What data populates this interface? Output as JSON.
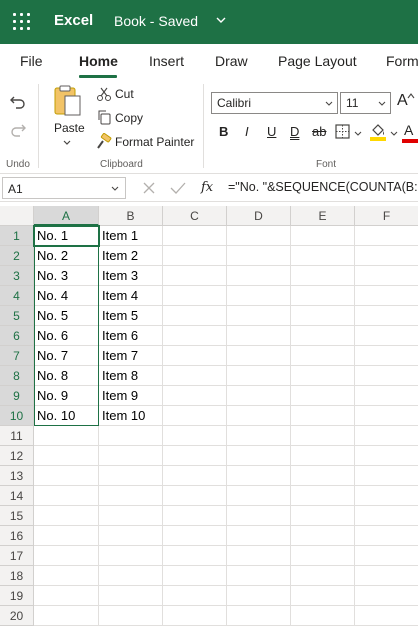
{
  "titlebar": {
    "app_name": "Excel",
    "doc_name": "Book - Saved",
    "waffle_icon": "app-launcher-icon"
  },
  "tabs": [
    {
      "label": "File"
    },
    {
      "label": "Home",
      "active": true
    },
    {
      "label": "Insert"
    },
    {
      "label": "Draw"
    },
    {
      "label": "Page Layout"
    },
    {
      "label": "Form"
    }
  ],
  "ribbon": {
    "undo_group_label": "Undo",
    "paste_label": "Paste",
    "cut_label": "Cut",
    "copy_label": "Copy",
    "format_painter_label": "Format Painter",
    "clipboard_group_label": "Clipboard",
    "font_name": "Calibri",
    "font_size": "11",
    "bold": "B",
    "italic": "I",
    "underline": "U",
    "double_underline": "D",
    "strikethrough": "ab",
    "font_group_label": "Font",
    "grow_font": "A",
    "font_color_letter": "A"
  },
  "formula_bar": {
    "name_box": "A1",
    "fx_label": "fx",
    "formula": "=\"No. \"&SEQUENCE(COUNTA(B:"
  },
  "grid": {
    "columns": [
      "A",
      "B",
      "C",
      "D",
      "E",
      "F"
    ],
    "rows": [
      "1",
      "2",
      "3",
      "4",
      "5",
      "6",
      "7",
      "8",
      "9",
      "10",
      "11",
      "12",
      "13",
      "14",
      "15",
      "16",
      "17",
      "18",
      "19",
      "20"
    ],
    "col_a": [
      "No. 1",
      "No. 2",
      "No. 3",
      "No. 4",
      "No. 5",
      "No. 6",
      "No. 7",
      "No. 8",
      "No. 9",
      "No. 10"
    ],
    "col_b": [
      "Item 1",
      "Item 2",
      "Item 3",
      "Item 4",
      "Item 5",
      "Item 6",
      "Item 7",
      "Item 8",
      "Item 9",
      "Item 10"
    ],
    "selected_column": "A",
    "active_cell": "A1"
  },
  "colors": {
    "brand": "#1e7145",
    "highlight": "#ffd800",
    "font_color": "#e00000"
  }
}
